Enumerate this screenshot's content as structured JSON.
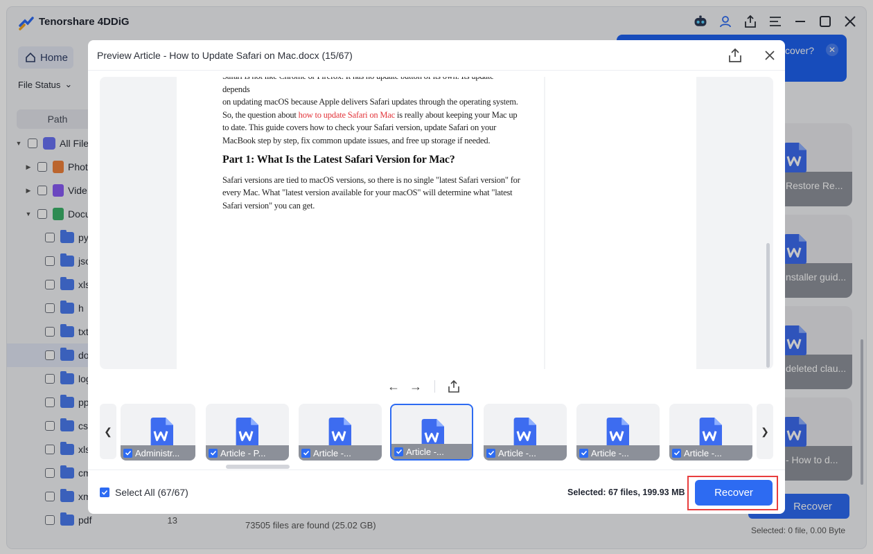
{
  "app": {
    "title": "Tenorshare 4DDiG"
  },
  "toolbar": {
    "icons": [
      "robot-icon",
      "user-icon",
      "upload-icon",
      "menu-icon",
      "minimize-icon",
      "maximize-icon",
      "close-icon"
    ]
  },
  "nav": {
    "home_label": "Home"
  },
  "tip": {
    "text": "cover?"
  },
  "filter": {
    "file_status_label": "File Status"
  },
  "sidebar": {
    "path_tab": "Path",
    "tree": [
      {
        "label": "All Files",
        "level": 0
      },
      {
        "label": "Phot",
        "level": 1
      },
      {
        "label": "Vide",
        "level": 1
      },
      {
        "label": "Docu",
        "level": 1
      },
      {
        "label": "py",
        "level": 2
      },
      {
        "label": "jso",
        "level": 2
      },
      {
        "label": "xls",
        "level": 2
      },
      {
        "label": "h",
        "level": 2
      },
      {
        "label": "txt",
        "level": 2
      },
      {
        "label": "do",
        "level": 2
      },
      {
        "label": "log",
        "level": 2
      },
      {
        "label": "pp",
        "level": 2
      },
      {
        "label": "csv",
        "level": 2
      },
      {
        "label": "xls",
        "level": 2
      },
      {
        "label": "cm",
        "level": 2
      },
      {
        "label": "xm",
        "level": 2
      },
      {
        "label": "pdf",
        "level": 2,
        "count": "13"
      }
    ]
  },
  "background_cards": [
    {
      "label": "Restore Re..."
    },
    {
      "label": "nstaller guid..."
    },
    {
      "label": "deleted clau..."
    },
    {
      "label": "- How to d..."
    }
  ],
  "status": {
    "found_text": "73505 files are found (25.02 GB)",
    "bg_recover_label": "Recover",
    "bg_selected": "Selected: 0 file, 0.00 Byte"
  },
  "modal": {
    "title": "Preview Article - How to Update Safari on Mac.docx (15/67)",
    "doc": {
      "line_cut": "Safari is not like Chrome or Firefox. It has no update button of its own. Its update depends",
      "para1_a": "on updating macOS because Apple delivers Safari updates through the operating system. So, the question about ",
      "para1_link": "how to update Safari on Mac",
      "para1_b": " is really about keeping your Mac up to date. This guide covers how to check your Safari version, update Safari on your MacBook step by step, fix common update issues, and free up storage if needed.",
      "heading": "Part 1: What Is the Latest Safari Version for Mac?",
      "para2": "Safari versions are tied to macOS versions, so there is no single \"latest Safari version\" for every Mac. What \"latest version available for your macOS\" will determine what \"latest Safari version\" you can get."
    },
    "thumbnails": [
      {
        "label": "Administr...",
        "selected": false
      },
      {
        "label": "Article - P...",
        "selected": false
      },
      {
        "label": "Article -...",
        "selected": false
      },
      {
        "label": "Article -...",
        "selected": true
      },
      {
        "label": "Article -...",
        "selected": false
      },
      {
        "label": "Article -...",
        "selected": false
      },
      {
        "label": "Article -...",
        "selected": false
      }
    ],
    "select_all_label": "Select All (67/67)",
    "selected_info": "Selected: 67 files, 199.93 MB",
    "recover_label": "Recover"
  },
  "colors": {
    "accent": "#2d6bf2",
    "highlight_frame": "#e83d3d",
    "link_red": "#e2343a"
  }
}
